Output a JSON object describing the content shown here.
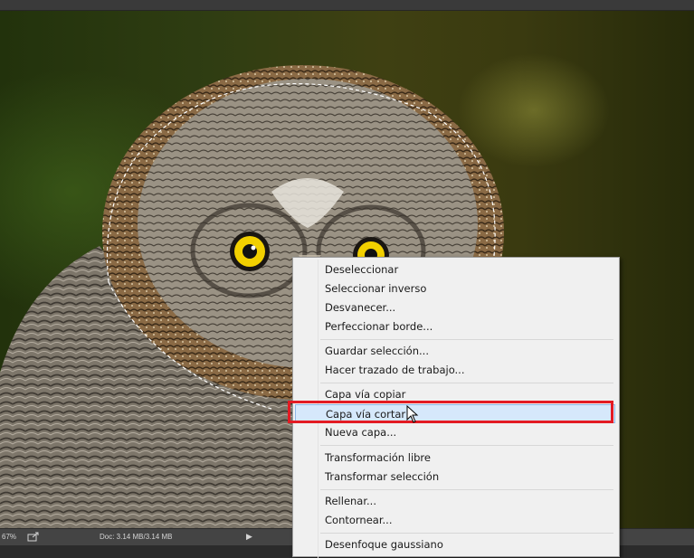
{
  "status": {
    "zoom": "67%",
    "doc_info": "Doc: 3.14 MB/3.14 MB",
    "arrow": "▶"
  },
  "context_menu": {
    "items": [
      "Deseleccionar",
      "Seleccionar inverso",
      "Desvanecer...",
      "Perfeccionar borde...",
      "Guardar selección...",
      "Hacer trazado de trabajo...",
      "Capa vía copiar",
      "Capa vía cortar",
      "Nueva capa...",
      "Transformación libre",
      "Transformar selección",
      "Rellenar...",
      "Contornear...",
      "Desenfoque gaussiano"
    ],
    "selected": "Capa vía cortar"
  },
  "colors": {
    "highlight": "#e31b23",
    "selected_bg": "#d6e8fb",
    "eye": "#f2d000"
  },
  "icons": [
    "share-icon",
    "mouse-pointer-icon"
  ]
}
